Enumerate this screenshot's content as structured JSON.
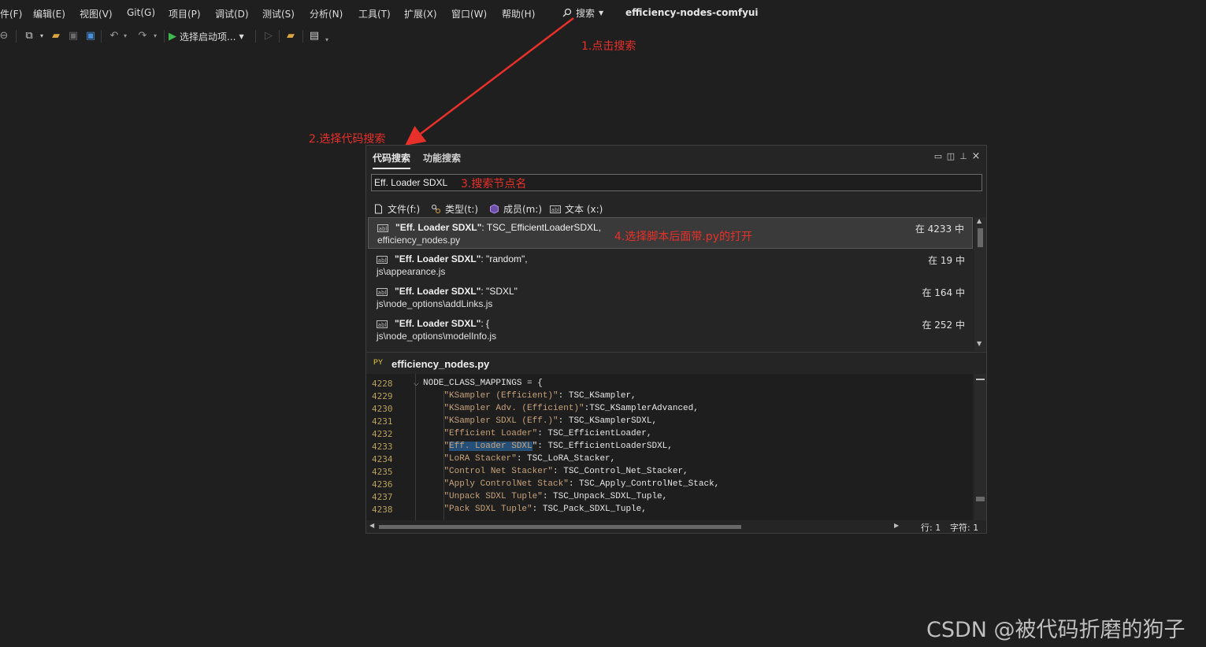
{
  "menu": {
    "items": [
      "件(F)",
      "编辑(E)",
      "视图(V)",
      "Git(G)",
      "项目(P)",
      "调试(D)",
      "测试(S)",
      "分析(N)",
      "工具(T)",
      "扩展(X)",
      "窗口(W)",
      "帮助(H)"
    ],
    "search_label": "搜索",
    "solution_title": "efficiency-nodes-comfyui"
  },
  "toolbar": {
    "start_label": "选择启动项..."
  },
  "annotations": {
    "step1": "1.点击搜索",
    "step2": "2.选择代码搜索",
    "step3": "3.搜索节点名",
    "step4": "4.选择脚本后面带.py的打开",
    "color": "#e8302a"
  },
  "panel": {
    "tabs": [
      "代码搜索",
      "功能搜索"
    ],
    "search_value": "Eff. Loader SDXL",
    "filters": [
      "文件(f:)",
      "类型(t:)",
      "成员(m:)",
      "文本 (x:)"
    ],
    "results": [
      {
        "key": "\"Eff. Loader SDXL\"",
        "rest": ": TSC_EfficientLoaderSDXL,",
        "path": "efficiency_nodes.py",
        "loc": "在 4233 中",
        "selected": true
      },
      {
        "key": "\"Eff. Loader SDXL\"",
        "rest": ": \"random\",",
        "path": "js\\appearance.js",
        "loc": "在 19 中",
        "selected": false
      },
      {
        "key": "\"Eff. Loader SDXL\"",
        "rest": ": \"SDXL\"",
        "path": "js\\node_options\\addLinks.js",
        "loc": "在 164 中",
        "selected": false
      },
      {
        "key": "\"Eff. Loader SDXL\"",
        "rest": ": {",
        "path": "js\\node_options\\modelInfo.js",
        "loc": "在 252 中",
        "selected": false
      }
    ],
    "preview": {
      "lang_badge": "PY",
      "file_name": "efficiency_nodes.py",
      "lines": [
        {
          "no": "4228",
          "pre": "NODE_CLASS_MAPPINGS = {",
          "str": "",
          "hl": "",
          "post": ""
        },
        {
          "no": "4229",
          "pre": "    ",
          "str": "\"KSampler (Efficient)\"",
          "hl": "",
          "post": ": TSC_KSampler,"
        },
        {
          "no": "4230",
          "pre": "    ",
          "str": "\"KSampler Adv. (Efficient)\"",
          "hl": "",
          "post": ":TSC_KSamplerAdvanced,"
        },
        {
          "no": "4231",
          "pre": "    ",
          "str": "\"KSampler SDXL (Eff.)\"",
          "hl": "",
          "post": ": TSC_KSamplerSDXL,"
        },
        {
          "no": "4232",
          "pre": "    ",
          "str": "\"Efficient Loader\"",
          "hl": "",
          "post": ": TSC_EfficientLoader,"
        },
        {
          "no": "4233",
          "pre": "    ",
          "str": "\"",
          "hl": "Eff. Loader SDXL",
          "post": "\": TSC_EfficientLoaderSDXL,"
        },
        {
          "no": "4234",
          "pre": "    ",
          "str": "\"LoRA Stacker\"",
          "hl": "",
          "post": ": TSC_LoRA_Stacker,"
        },
        {
          "no": "4235",
          "pre": "    ",
          "str": "\"Control Net Stacker\"",
          "hl": "",
          "post": ": TSC_Control_Net_Stacker,"
        },
        {
          "no": "4236",
          "pre": "    ",
          "str": "\"Apply ControlNet Stack\"",
          "hl": "",
          "post": ": TSC_Apply_ControlNet_Stack,"
        },
        {
          "no": "4237",
          "pre": "    ",
          "str": "\"Unpack SDXL Tuple\"",
          "hl": "",
          "post": ": TSC_Unpack_SDXL_Tuple,"
        },
        {
          "no": "4238",
          "pre": "    ",
          "str": "\"Pack SDXL Tuple\"",
          "hl": "",
          "post": ": TSC_Pack_SDXL_Tuple,"
        }
      ]
    },
    "status": {
      "line": "行: 1",
      "char": "字符: 1"
    }
  },
  "watermark": "CSDN @被代码折磨的狗子"
}
